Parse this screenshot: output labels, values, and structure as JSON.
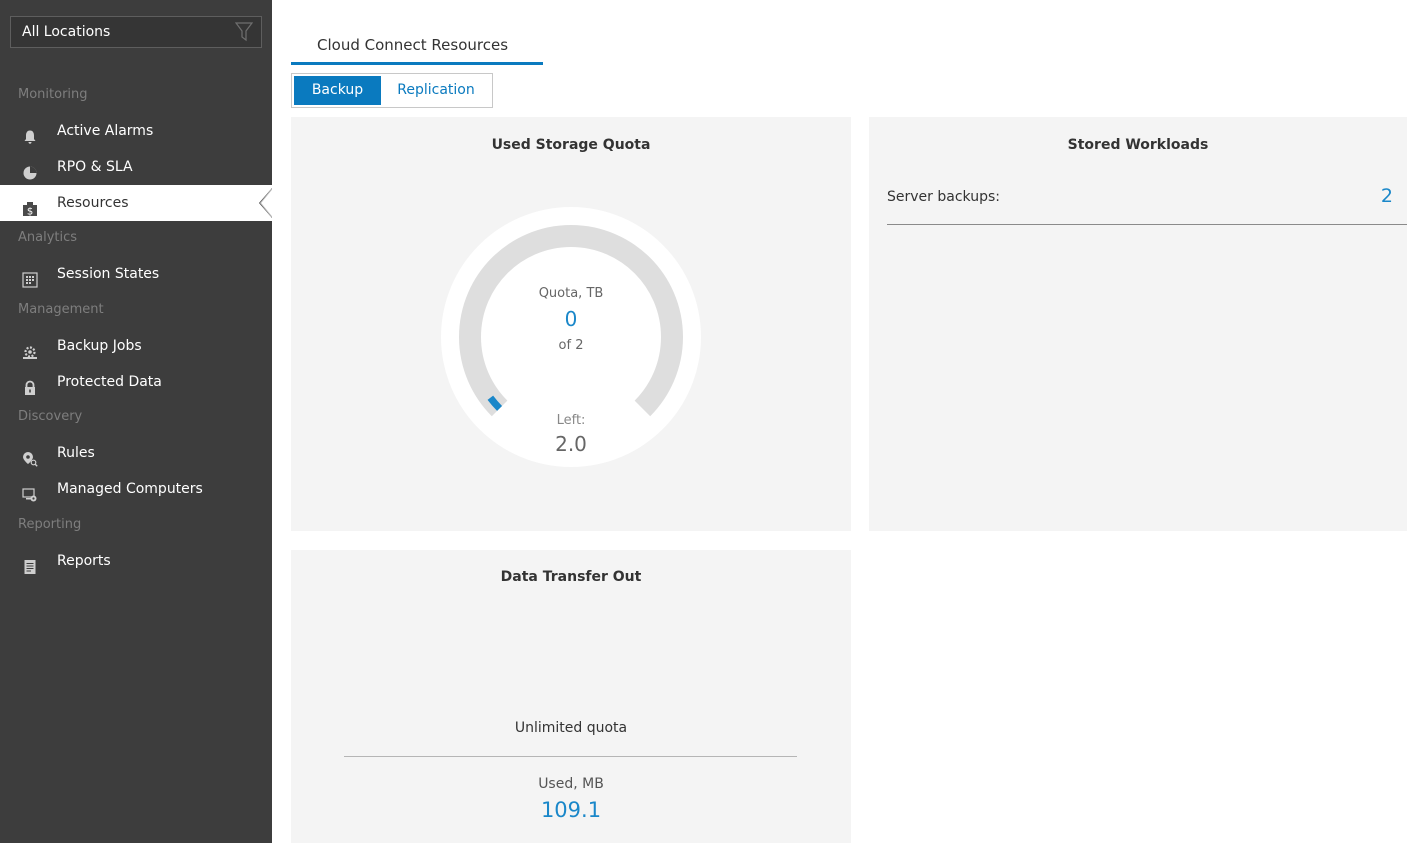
{
  "sidebar": {
    "location_filter": "All Locations",
    "sections": {
      "monitoring": "Monitoring",
      "analytics": "Analytics",
      "management": "Management",
      "discovery": "Discovery",
      "reporting": "Reporting"
    },
    "items": {
      "active_alarms": "Active Alarms",
      "rpo_sla": "RPO & SLA",
      "resources": "Resources",
      "session_states": "Session States",
      "backup_jobs": "Backup Jobs",
      "protected_data": "Protected Data",
      "rules": "Rules",
      "managed_computers": "Managed Computers",
      "reports": "Reports"
    },
    "active_item": "Resources"
  },
  "main": {
    "tab": "Cloud Connect Resources",
    "toggle": {
      "backup": "Backup",
      "replication": "Replication",
      "selected": "Backup"
    },
    "used_storage_quota": {
      "title": "Used Storage Quota",
      "quota_label": "Quota, TB",
      "used": "0",
      "of": "of 2",
      "left_label": "Left:",
      "left_value": "2.0",
      "fill_fraction": 0.0
    },
    "stored_workloads": {
      "title": "Stored Workloads",
      "server_backups_label": "Server backups:",
      "server_backups_value": "2"
    },
    "data_transfer_out": {
      "title": "Data Transfer Out",
      "quota_text": "Unlimited quota",
      "used_label": "Used, MB",
      "used_value": "109.1"
    }
  },
  "colors": {
    "sidebar_bg": "#3d3d3d",
    "accent": "#0a7abf",
    "value_blue": "#1a87c9",
    "panel_bg": "#f4f4f4"
  }
}
